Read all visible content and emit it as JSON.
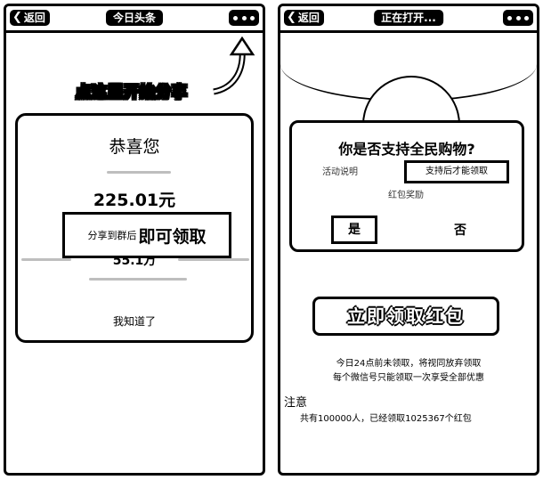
{
  "left": {
    "topbar": {
      "back_label": "返回",
      "title": "今日头条"
    },
    "hint": "点这里开始分享",
    "modal": {
      "title": "恭喜您",
      "amount": "225.01元",
      "highlight_small": "分享到群后",
      "highlight_big": "即可领取",
      "sub_amount": "55.1万",
      "footer": "我知道了"
    }
  },
  "right": {
    "topbar": {
      "back_label": "返回",
      "title": "正在打开..."
    },
    "modal": {
      "question": "你是否支持全民购物?",
      "desc": "活动说明",
      "boxed": "支持后才能领取",
      "desc2": "红包奖励",
      "yes": "是",
      "no": "否"
    },
    "claim_button": "立即领取红包",
    "note_line1": "今日24点前未领取，将视同放弃领取",
    "note_line2": "每个微信号只能领取一次享受全部优惠",
    "rules_title": "注意",
    "rules_text": "共有100000人，已经领取1025367个红包"
  }
}
